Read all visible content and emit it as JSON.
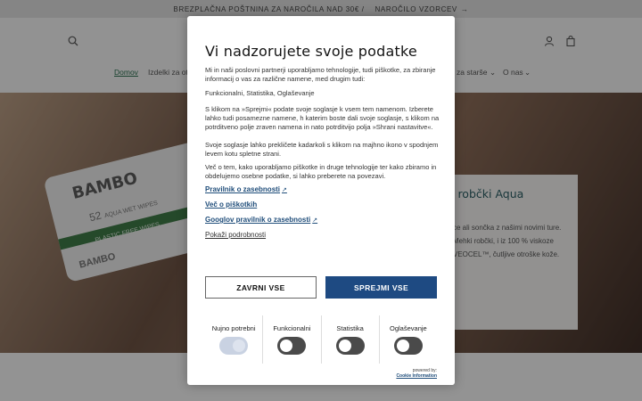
{
  "announcement": {
    "shipping": "BREZPLAČNA POŠTNINA ZA NAROČILA NAD 30€ /",
    "samples": "NAROČILO VZORCEV",
    "arrow": "→"
  },
  "header": {
    "search_icon": "search-icon",
    "account_icon": "account-icon",
    "cart_icon": "cart-icon"
  },
  "nav": {
    "home": "Domov",
    "products": "Izdelki za ot",
    "parents": "za starše",
    "about": "O nas"
  },
  "hero": {
    "pack_brand": "BAMBO",
    "pack_count": "52",
    "pack_sub": "AQUA WET WIPES",
    "pack_strip": "PLASTIC FREE WIPES",
    "pack_brand2": "BAMBO",
    "card_title": "i robčki Aqua",
    "card_text": "ce ali sončka z našimi novimi ture. Mehki robčki, i iz 100 % viskoze VEOCEL™, čutljive otroške kože."
  },
  "dialog": {
    "title": "Vi nadzorujete svoje podatke",
    "intro": "Mi in naši poslovni partnerji uporabljamo tehnologije, tudi piškotke, za zbiranje informacij o vas za različne namene, med drugim tudi:",
    "purposes": "Funkcionalni, Statistika, Oglaševanje",
    "consent": "S klikom na »Sprejmi« podate svoje soglasje k vsem tem namenom. Izberete lahko tudi posamezne namene, h katerim boste dali svoje soglasje, s klikom na potrditveno polje zraven namena in nato potrditvijo polja »Shrani nastavitve«.",
    "revoke": "Svoje soglasje lahko prekličete kadarkoli s klikom na majhno ikono v spodnjem levem kotu spletne strani.",
    "more": "Več o tem, kako uporabljamo piškotke in druge tehnologije ter kako zbiramo in obdelujemo osebne podatke, si lahko preberete na povezavi.",
    "link_privacy": "Pravilnik o zasebnosti",
    "link_cookies": "Več o piškotkih",
    "link_google": "Googlov pravilnik o zasebnosti",
    "link_details": "Pokaži podrobnosti",
    "reject_label": "ZAVRNI VSE",
    "accept_label": "SPREJMI VSE",
    "categories": [
      {
        "label": "Nujno potrebni",
        "state": "on",
        "disabled": true
      },
      {
        "label": "Funkcionalni",
        "state": "off",
        "disabled": false
      },
      {
        "label": "Statistika",
        "state": "off",
        "disabled": false
      },
      {
        "label": "Oglaševanje",
        "state": "off",
        "disabled": false
      }
    ],
    "powered_by": "powered by:",
    "powered_name": "Cookie Information"
  },
  "colors": {
    "accept_bg": "#1e4a82",
    "link": "#1f4d7a",
    "nav_active": "#2c6e4f"
  }
}
